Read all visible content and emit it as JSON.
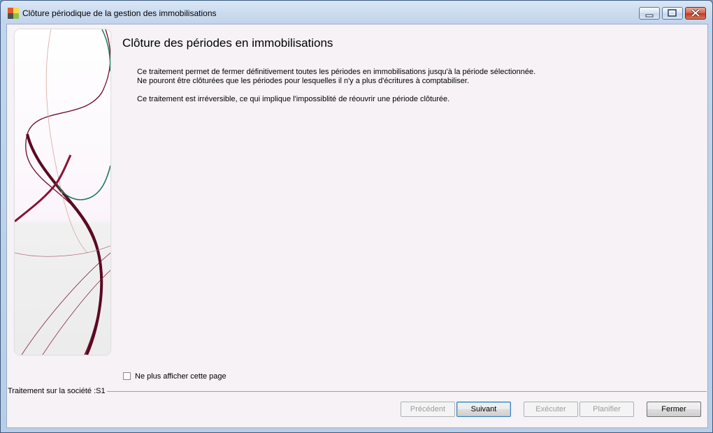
{
  "window": {
    "title": "Clôture périodique de la gestion des immobilisations",
    "controls": [
      "minimize-icon",
      "maximize-icon",
      "close-icon"
    ]
  },
  "page": {
    "title": "Clôture des périodes en immobilisations",
    "description_lines": [
      "Ce traitement permet de fermer définitivement toutes les périodes en  immobilisations jusqu'à la période sélectionnée.",
      "Ne pouront être clôturées que les périodes pour lesquelles il n'y a plus d'écritures à comptabiliser.",
      "Ce traitement est irréversible, ce qui implique l'impossiblité de réouvrir une période clôturée."
    ]
  },
  "checkbox": {
    "label": "Ne plus afficher cette page",
    "checked": false
  },
  "status": {
    "text": "Traitement sur la société :S1"
  },
  "buttons": {
    "previous": "Précédent",
    "next": "Suivant",
    "execute": "Exécuter",
    "schedule": "Planifier",
    "close": "Fermer"
  },
  "colors": {
    "accent_wine": "#6b0f2a",
    "accent_green": "#1f7a5a"
  }
}
